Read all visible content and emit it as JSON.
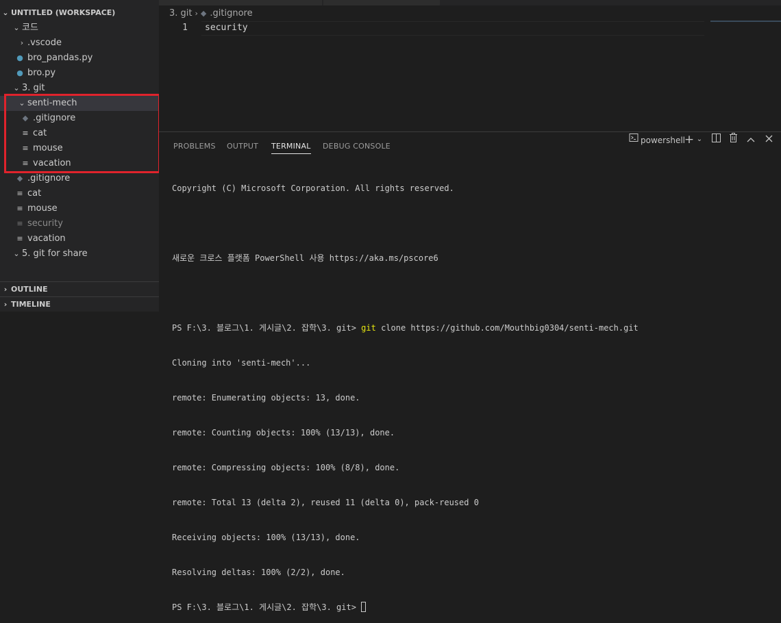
{
  "sidebar": {
    "workspace_title": "UNTITLED (WORKSPACE)",
    "tree": {
      "folder_code": "코드",
      "vscode": ".vscode",
      "bro_pandas": "bro_pandas.py",
      "bro": "bro.py",
      "folder_git": "3. git",
      "senti_mech": "senti-mech",
      "inner_gitignore": ".gitignore",
      "inner_cat": "cat",
      "inner_mouse": "mouse",
      "inner_vacation": "vacation",
      "gitignore": ".gitignore",
      "cat": "cat",
      "mouse": "mouse",
      "security": "security",
      "vacation": "vacation",
      "folder_git_share": "5. git for share"
    },
    "outline_label": "OUTLINE",
    "timeline_label": "TIMELINE"
  },
  "editor": {
    "breadcrumb_folder": "3. git",
    "breadcrumb_file": ".gitignore",
    "line_number": "1",
    "line_text": "security"
  },
  "panel": {
    "tabs": {
      "problems": "PROBLEMS",
      "output": "OUTPUT",
      "terminal": "TERMINAL",
      "debug_console": "DEBUG CONSOLE"
    },
    "shell": "powershell",
    "terminal": {
      "copyright": "Copyright (C) Microsoft Corporation. All rights reserved.",
      "pscore_note": "새로운 크로스 플랫폼 PowerShell 사용 https://aka.ms/pscore6",
      "prompt": "PS F:\\3. 블로그\\1. 게시글\\2. 잡학\\3. git> ",
      "git_word": "git",
      "clone_args": " clone https://github.com/Mouthbig0304/senti-mech.git",
      "output_lines": [
        "Cloning into 'senti-mech'...",
        "remote: Enumerating objects: 13, done.",
        "remote: Counting objects: 100% (13/13), done.",
        "remote: Compressing objects: 100% (8/8), done.",
        "remote: Total 13 (delta 2), reused 11 (delta 0), pack-reused 0",
        "Receiving objects: 100% (13/13), done.",
        "Resolving deltas: 100% (2/2), done."
      ],
      "final_prompt": "PS F:\\3. 블로그\\1. 게시글\\2. 잡학\\3. git> "
    }
  },
  "colors": {
    "highlight_box": "#e0232c",
    "git_command": "#e5e510",
    "python_icon": "#519aba"
  }
}
